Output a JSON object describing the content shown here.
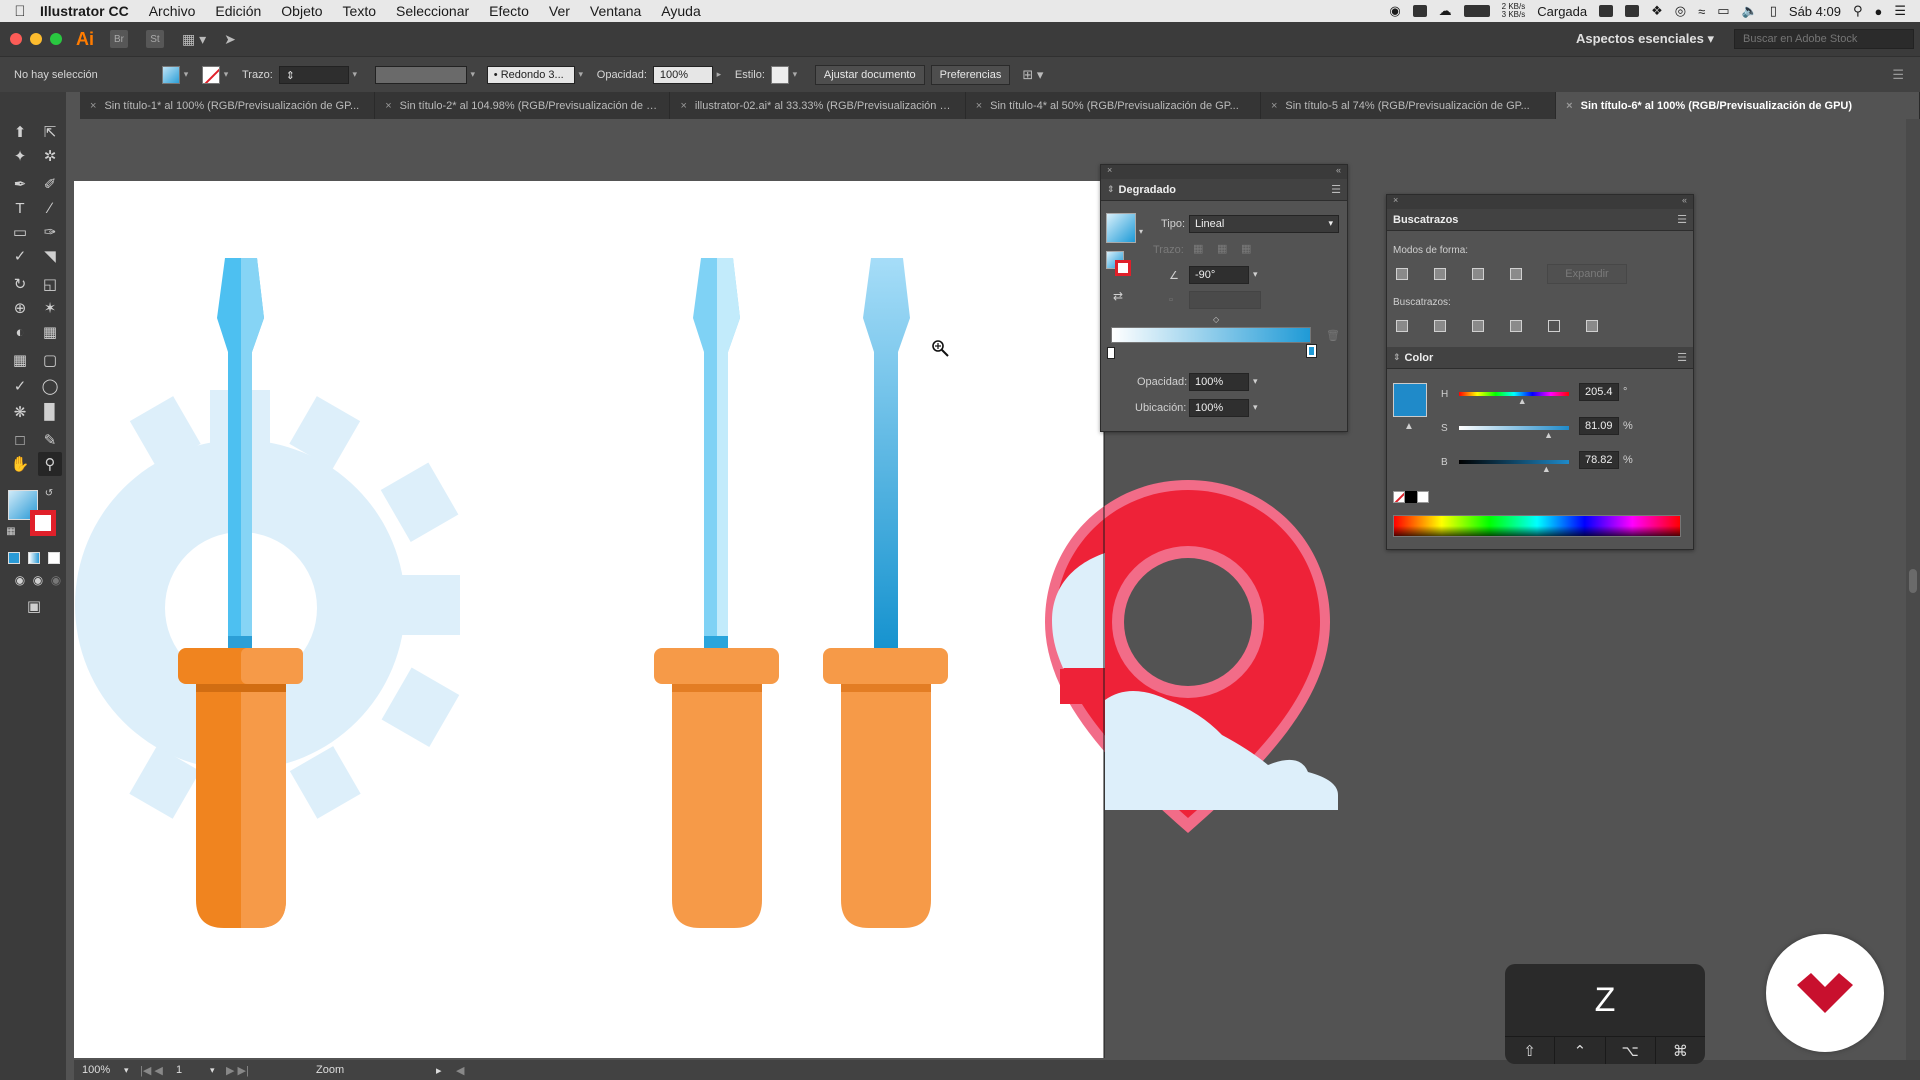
{
  "menubar": {
    "app_name": "Illustrator CC",
    "menus": [
      "Archivo",
      "Edición",
      "Objeto",
      "Texto",
      "Seleccionar",
      "Efecto",
      "Ver",
      "Ventana",
      "Ayuda"
    ],
    "net_up": "2 KB/s",
    "net_down": "3 KB/s",
    "battery_status": "Cargada",
    "clock": "Sáb 4:09"
  },
  "appbar": {
    "logo": "Ai",
    "bridge": "Br",
    "stock": "St",
    "workspace": "Aspectos esenciales",
    "stock_search_placeholder": "Buscar en Adobe Stock"
  },
  "control": {
    "selection": "No hay selección",
    "stroke_label": "Trazo:",
    "brush_value": "Redondo 3...",
    "opacity_label": "Opacidad:",
    "opacity_value": "100%",
    "style_label": "Estilo:",
    "fit_button": "Ajustar documento",
    "prefs_button": "Preferencias"
  },
  "tabs": [
    {
      "label": "Sin título-1* al 100% (RGB/Previsualización de GP...",
      "active": false
    },
    {
      "label": "Sin título-2* al 104.98% (RGB/Previsualización de GP...",
      "active": false
    },
    {
      "label": "illustrator-02.ai* al 33.33% (RGB/Previsualización de ...",
      "active": false
    },
    {
      "label": "Sin título-4* al 50% (RGB/Previsualización de GP...",
      "active": false
    },
    {
      "label": "Sin título-5 al 74% (RGB/Previsualización de GP...",
      "active": false
    },
    {
      "label": "Sin título-6* al 100% (RGB/Previsualización de GPU)",
      "active": true
    }
  ],
  "gradient_panel": {
    "title": "Degradado",
    "type_label": "Tipo:",
    "type_value": "Lineal",
    "stroke_label": "Trazo:",
    "angle_value": "-90°",
    "opacity_label": "Opacidad:",
    "opacity_value": "100%",
    "location_label": "Ubicación:",
    "location_value": "100%",
    "start_color": "#ffffff",
    "end_color": "#1f9ad6"
  },
  "pathfinder_panel": {
    "title": "Buscatrazos",
    "shape_modes_label": "Modos de forma:",
    "expand_button": "Expandir",
    "pathfinders_label": "Buscatrazos:"
  },
  "color_panel": {
    "title": "Color",
    "swatch": "#1f8ac9",
    "h_label": "H",
    "h_value": "205.4",
    "h_unit": "°",
    "h_level": 0.57,
    "s_label": "S",
    "s_value": "81.09",
    "s_unit": "%",
    "s_level": 0.81,
    "b_label": "B",
    "b_value": "78.82",
    "b_unit": "%",
    "b_level": 0.79
  },
  "status": {
    "zoom": "100%",
    "artboard": "1",
    "tool": "Zoom"
  },
  "key_overlay": {
    "key": "Z",
    "mods": [
      "⇧",
      "⌃",
      "⌥",
      "⌘"
    ]
  }
}
